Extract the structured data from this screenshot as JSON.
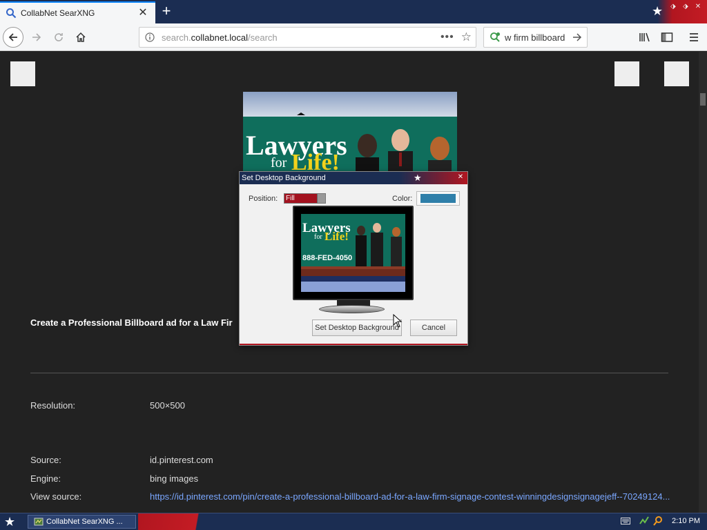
{
  "browser": {
    "tab_title": "CollabNet SearXNG",
    "url_domain": "search.",
    "url_host": "collabnet.local",
    "url_path": "/search",
    "search_query": "w firm billboard"
  },
  "result": {
    "title": "Create a Professional Billboard ad for a Law Fir",
    "billboard_heading": "Lawyers",
    "billboard_sub_for": "for",
    "billboard_sub_life": "Life!",
    "billboard_phone": "888-FED-4050",
    "fields": [
      {
        "label": "Resolution:",
        "value": "500×500"
      },
      {
        "label": "Source:",
        "value": "id.pinterest.com"
      },
      {
        "label": "Engine:",
        "value": "bing images"
      },
      {
        "label": "View source:",
        "value": "https://id.pinterest.com/pin/create-a-professional-billboard-ad-for-a-law-firm-signage-contest-winningdesignsignagejeff--70249124..."
      }
    ]
  },
  "dialog": {
    "title": "Set Desktop Background",
    "position_label": "Position:",
    "position_value": "Fill",
    "color_label": "Color:",
    "color_value": "#2f7fa9",
    "set_button": "Set Desktop Background",
    "cancel_button": "Cancel"
  },
  "taskbar": {
    "task_label": "CollabNet SearXNG ...",
    "clock": "2:10 PM"
  },
  "colors": {
    "accent_red": "#b11620",
    "navy": "#1b2d52",
    "link": "#7aa7ff"
  }
}
